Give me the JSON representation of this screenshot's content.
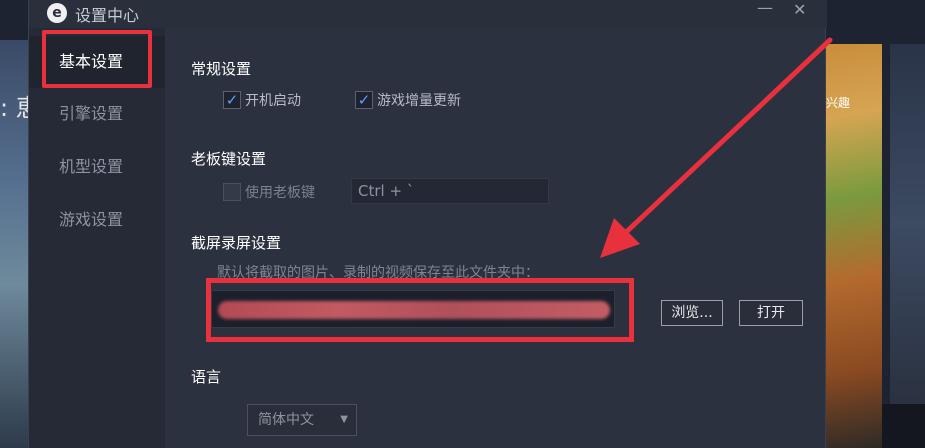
{
  "background": {
    "left_text": ": 恵",
    "right_game_label": "兴趣"
  },
  "window": {
    "title": "设置中心",
    "minimize_glyph": "—",
    "close_glyph": "✕",
    "logo_glyph": "e"
  },
  "sidebar": {
    "items": [
      {
        "label": "基本设置",
        "active": true
      },
      {
        "label": "引擎设置",
        "active": false
      },
      {
        "label": "机型设置",
        "active": false
      },
      {
        "label": "游戏设置",
        "active": false
      }
    ]
  },
  "general": {
    "title": "常规设置",
    "autostart": {
      "label": "开机启动",
      "checked": true
    },
    "incremental_update": {
      "label": "游戏增量更新",
      "checked": true
    }
  },
  "boss_key": {
    "title": "老板键设置",
    "enable": {
      "label": "使用老板键",
      "checked": false
    },
    "hotkey_value": "Ctrl + `"
  },
  "screenshot": {
    "title": "截屏录屏设置",
    "hint": "默认将截取的图片、录制的视频保存至此文件夹中：",
    "path_value": "",
    "browse_label": "浏览...",
    "open_label": "打开"
  },
  "language": {
    "title": "语言",
    "selected": "简体中文"
  },
  "colors": {
    "annotation_red": "#e8313d",
    "accent_blue": "#5aa0ff"
  }
}
